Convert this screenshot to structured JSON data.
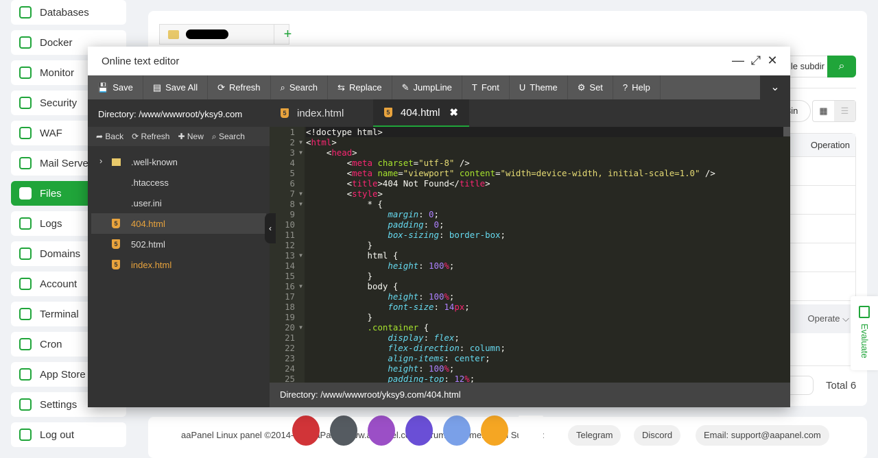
{
  "sidebar": {
    "items": [
      {
        "label": "Databases",
        "icon": "database-icon"
      },
      {
        "label": "Docker",
        "icon": "docker-icon"
      },
      {
        "label": "Monitor",
        "icon": "monitor-icon"
      },
      {
        "label": "Security",
        "icon": "shield-icon"
      },
      {
        "label": "WAF",
        "icon": "firewall-icon"
      },
      {
        "label": "Mail Server",
        "icon": "mail-icon"
      },
      {
        "label": "Files",
        "icon": "folder-icon",
        "active": true
      },
      {
        "label": "Logs",
        "icon": "log-icon"
      },
      {
        "label": "Domains",
        "icon": "domain-icon"
      },
      {
        "label": "Account",
        "icon": "user-icon"
      },
      {
        "label": "Terminal",
        "icon": "terminal-icon"
      },
      {
        "label": "Cron",
        "icon": "clock-icon"
      },
      {
        "label": "App Store",
        "icon": "store-icon"
      },
      {
        "label": "Settings",
        "icon": "gear-icon"
      },
      {
        "label": "Log out",
        "icon": "logout-icon"
      }
    ]
  },
  "background": {
    "subdir_label": "le subdir",
    "bin_label": "3in",
    "operation_header": "Operation",
    "operate_label": "Operate ⌵",
    "total": "Total 6",
    "accent": "#20a53a"
  },
  "footer": {
    "copyright": "aaPanel Linux panel ©2014-2… aaPanel  www.aapanel.com  Forum  Documentation  Support:",
    "telegram": "Telegram",
    "discord": "Discord",
    "email": "Email: support@aapanel.com"
  },
  "evaluate": "Evaluate",
  "editor": {
    "title": "Online text editor",
    "toolbar": [
      {
        "label": "Save",
        "icon": "save-icon",
        "g": "💾"
      },
      {
        "label": "Save All",
        "icon": "save-all-icon",
        "g": "▤"
      },
      {
        "label": "Refresh",
        "icon": "refresh-icon",
        "g": "⟳"
      },
      {
        "label": "Search",
        "icon": "search-icon",
        "g": "⌕"
      },
      {
        "label": "Replace",
        "icon": "replace-icon",
        "g": "⇆"
      },
      {
        "label": "JumpLine",
        "icon": "pin-icon",
        "g": "✎"
      },
      {
        "label": "Font",
        "icon": "font-icon",
        "g": "T"
      },
      {
        "label": "Theme",
        "icon": "magnet-icon",
        "g": "U"
      },
      {
        "label": "Set",
        "icon": "gear-icon",
        "g": "⚙"
      },
      {
        "label": "Help",
        "icon": "help-icon",
        "g": "?"
      }
    ],
    "directory": "Directory: /www/wwwroot/yksy9.com",
    "file_tools": [
      "➦ Back",
      "⟳ Refresh",
      "✚ New",
      "⌕ Search"
    ],
    "files": [
      {
        "name": ".well-known",
        "type": "folder"
      },
      {
        "name": ".htaccess",
        "type": "file"
      },
      {
        "name": ".user.ini",
        "type": "file"
      },
      {
        "name": "404.html",
        "type": "html",
        "selected": true
      },
      {
        "name": "502.html",
        "type": "html"
      },
      {
        "name": "index.html",
        "type": "html"
      }
    ],
    "tabs": [
      {
        "label": "index.html"
      },
      {
        "label": "404.html",
        "active": true,
        "close": "✖"
      }
    ],
    "status": "Directory: /www/wwwroot/yksy9.com/404.html",
    "fold_lines": [
      2,
      3,
      7,
      8,
      13,
      16,
      20
    ],
    "lines": [
      [
        [
          "txt",
          "<!doctype html>"
        ]
      ],
      [
        [
          "txt",
          "<"
        ],
        [
          "tag",
          "html"
        ],
        [
          "txt",
          ">"
        ]
      ],
      [
        [
          "txt",
          "    <"
        ],
        [
          "tag",
          "head"
        ],
        [
          "txt",
          ">"
        ]
      ],
      [
        [
          "txt",
          "        <"
        ],
        [
          "tag",
          "meta"
        ],
        [
          "txt",
          " "
        ],
        [
          "attr",
          "charset"
        ],
        [
          "txt",
          "="
        ],
        [
          "str",
          "\"utf-8\""
        ],
        [
          "txt",
          " />"
        ]
      ],
      [
        [
          "txt",
          "        <"
        ],
        [
          "tag",
          "meta"
        ],
        [
          "txt",
          " "
        ],
        [
          "attr",
          "name"
        ],
        [
          "txt",
          "="
        ],
        [
          "str",
          "\"viewport\""
        ],
        [
          "txt",
          " "
        ],
        [
          "attr",
          "content"
        ],
        [
          "txt",
          "="
        ],
        [
          "str",
          "\"width=device-width, initial-scale=1.0\""
        ],
        [
          "txt",
          " />"
        ]
      ],
      [
        [
          "txt",
          "        <"
        ],
        [
          "tag",
          "title"
        ],
        [
          "txt",
          ">404 Not Found</"
        ],
        [
          "tag",
          "title"
        ],
        [
          "txt",
          ">"
        ]
      ],
      [
        [
          "txt",
          "        <"
        ],
        [
          "tag",
          "style"
        ],
        [
          "txt",
          ">"
        ]
      ],
      [
        [
          "txt",
          "            * {"
        ]
      ],
      [
        [
          "txt",
          "                "
        ],
        [
          "prop",
          "margin"
        ],
        [
          "txt",
          ": "
        ],
        [
          "num",
          "0"
        ],
        [
          "txt",
          ";"
        ]
      ],
      [
        [
          "txt",
          "                "
        ],
        [
          "prop",
          "padding"
        ],
        [
          "txt",
          ": "
        ],
        [
          "num",
          "0"
        ],
        [
          "txt",
          ";"
        ]
      ],
      [
        [
          "txt",
          "                "
        ],
        [
          "prop",
          "box-sizing"
        ],
        [
          "txt",
          ": "
        ],
        [
          "val",
          "border-box"
        ],
        [
          "txt",
          ";"
        ]
      ],
      [
        [
          "txt",
          "            }"
        ]
      ],
      [
        [
          "txt",
          "            html {"
        ]
      ],
      [
        [
          "txt",
          "                "
        ],
        [
          "prop",
          "height"
        ],
        [
          "txt",
          ": "
        ],
        [
          "num",
          "100"
        ],
        [
          "unit",
          "%"
        ],
        [
          "txt",
          ";"
        ]
      ],
      [
        [
          "txt",
          "            }"
        ]
      ],
      [
        [
          "txt",
          "            body {"
        ]
      ],
      [
        [
          "txt",
          "                "
        ],
        [
          "prop",
          "height"
        ],
        [
          "txt",
          ": "
        ],
        [
          "num",
          "100"
        ],
        [
          "unit",
          "%"
        ],
        [
          "txt",
          ";"
        ]
      ],
      [
        [
          "txt",
          "                "
        ],
        [
          "prop",
          "font-size"
        ],
        [
          "txt",
          ": "
        ],
        [
          "num",
          "14"
        ],
        [
          "unit",
          "px"
        ],
        [
          "txt",
          ";"
        ]
      ],
      [
        [
          "txt",
          "            }"
        ]
      ],
      [
        [
          "txt",
          "            "
        ],
        [
          "sel",
          ".container"
        ],
        [
          "txt",
          " {"
        ]
      ],
      [
        [
          "txt",
          "                "
        ],
        [
          "prop",
          "display"
        ],
        [
          "txt",
          ": "
        ],
        [
          "prop",
          "flex"
        ],
        [
          "txt",
          ";"
        ]
      ],
      [
        [
          "txt",
          "                "
        ],
        [
          "prop",
          "flex-direction"
        ],
        [
          "txt",
          ": "
        ],
        [
          "val",
          "column"
        ],
        [
          "txt",
          ";"
        ]
      ],
      [
        [
          "txt",
          "                "
        ],
        [
          "prop",
          "align-items"
        ],
        [
          "txt",
          ": "
        ],
        [
          "val",
          "center"
        ],
        [
          "txt",
          ";"
        ]
      ],
      [
        [
          "txt",
          "                "
        ],
        [
          "prop",
          "height"
        ],
        [
          "txt",
          ": "
        ],
        [
          "num",
          "100"
        ],
        [
          "unit",
          "%"
        ],
        [
          "txt",
          ";"
        ]
      ],
      [
        [
          "txt",
          "                "
        ],
        [
          "prop",
          "padding-top"
        ],
        [
          "txt",
          ": "
        ],
        [
          "num",
          "12"
        ],
        [
          "unit",
          "%"
        ],
        [
          "txt",
          ";"
        ]
      ]
    ]
  },
  "dock": [
    {
      "icon": "app-red-icon",
      "color": "#d13438"
    },
    {
      "icon": "terminal-app-icon",
      "color": "#555b61"
    },
    {
      "icon": "quote-app-icon",
      "color": "#9b4fc6"
    },
    {
      "icon": "app-purple-icon",
      "color": "#6a4fd6"
    },
    {
      "icon": "app-blue-icon",
      "color": "#7aa0e8"
    },
    {
      "icon": "brave-icon",
      "color": "#f5a623"
    },
    {
      "icon": "recycle-icon",
      "color": "#ffffff"
    }
  ]
}
